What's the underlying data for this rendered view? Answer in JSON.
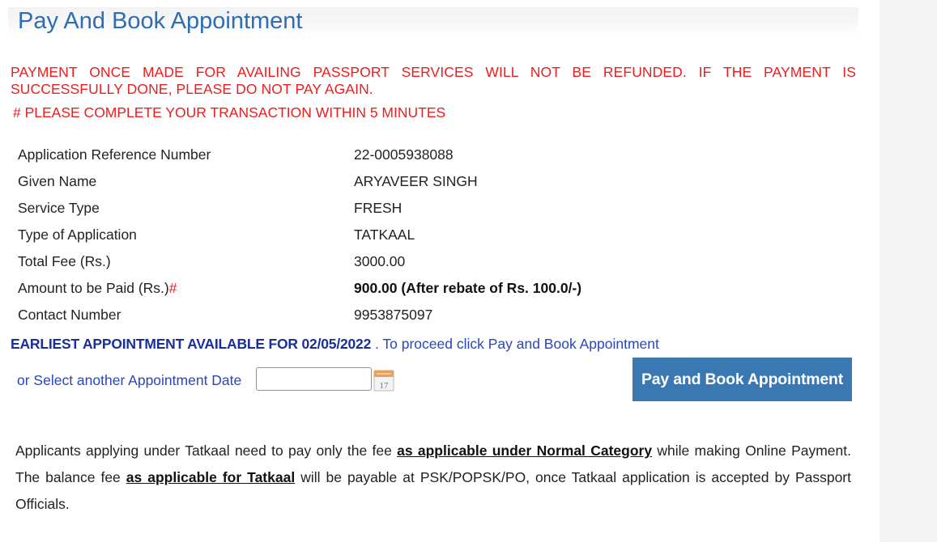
{
  "page": {
    "title": "Pay And Book Appointment"
  },
  "warnings": {
    "refund": "PAYMENT ONCE MADE FOR AVAILING PASSPORT SERVICES WILL NOT BE REFUNDED. IF THE PAYMENT IS SUCCESSFULLY DONE, PLEASE DO NOT PAY AGAIN.",
    "timeout": "# PLEASE COMPLETE YOUR TRANSACTION WITHIN 5 MINUTES"
  },
  "details": {
    "rows": [
      {
        "label": "Application Reference Number",
        "value": "22-0005938088"
      },
      {
        "label": "Given Name",
        "value": "ARYAVEER SINGH"
      },
      {
        "label": "Service Type",
        "value": "FRESH"
      },
      {
        "label": "Type of Application",
        "value": "TATKAAL"
      },
      {
        "label": "Total Fee (Rs.)",
        "value": "3000.00"
      },
      {
        "label": "Amount to be Paid (Rs.)",
        "label_mark": "#",
        "value": "900.00 (After rebate of Rs. 100.0/-)"
      },
      {
        "label": "Contact Number",
        "value": "9953875097"
      }
    ]
  },
  "appointment": {
    "earliest_text": "EARLIEST APPOINTMENT AVAILABLE FOR 02/05/2022",
    "proceed_text": " . To proceed click Pay and Book Appointment",
    "select_label": "or Select another Appointment Date",
    "date_value": "",
    "calendar_icon_day": "17",
    "calendar_icon": "calendar-icon"
  },
  "button": {
    "pay_label": "Pay and Book Appointment"
  },
  "note": {
    "part1": "Applicants applying under Tatkaal need to pay only the fee ",
    "link1": "as applicable under Normal Category",
    "part2": " while making Online Payment. The balance fee ",
    "link2": "as applicable for Tatkaal",
    "part3": " will be payable at PSK/POPSK/PO, once Tatkaal application is accepted by Passport Officials."
  },
  "colors": {
    "title": "#2e6db4",
    "warning": "#ee1c1c",
    "earliest": "#1a2f9a",
    "link_text": "#2a46b8",
    "button": "#3a78b4"
  }
}
